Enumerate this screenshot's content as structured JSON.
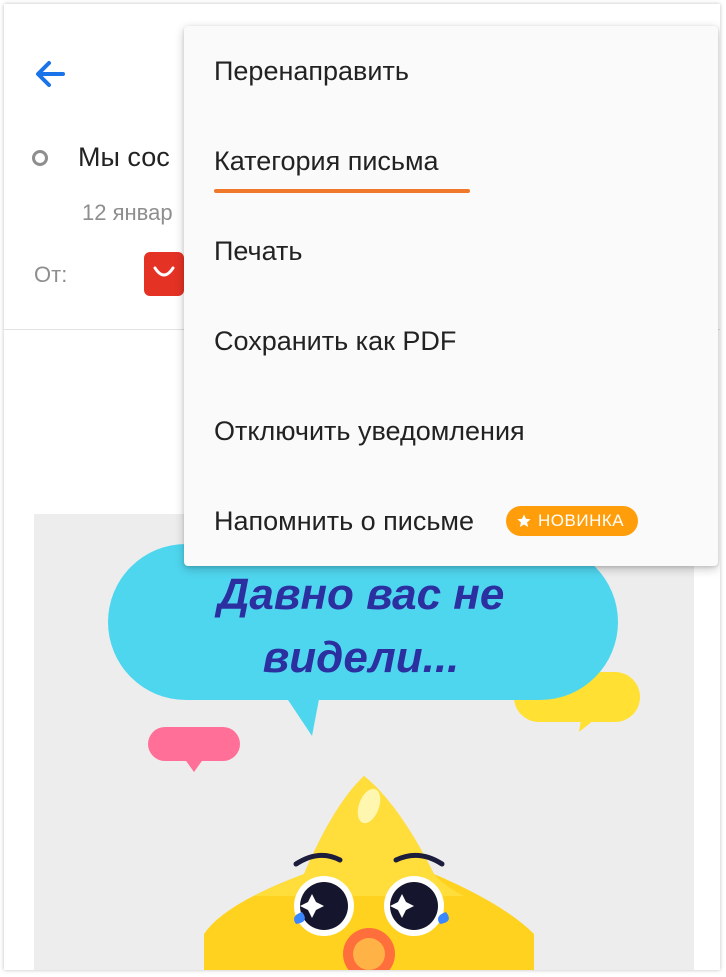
{
  "header": {
    "back_icon": "arrow-left-icon",
    "subject": "Мы сос",
    "date": "12 январ",
    "from_label": "От:"
  },
  "menu": {
    "items": [
      {
        "label": "Перенаправить"
      },
      {
        "label": "Категория письма"
      },
      {
        "label": "Печать"
      },
      {
        "label": "Сохранить как PDF"
      },
      {
        "label": "Отключить уведомления"
      },
      {
        "label": "Напомнить о письме",
        "badge": "НОВИНКА"
      }
    ]
  },
  "promo": {
    "headline_line1": "Давно вас не",
    "headline_line2": "видели..."
  },
  "colors": {
    "accent_blue": "#1a73e8",
    "underline_orange": "#f0782a",
    "badge_orange": "#ff9e0a",
    "bubble_cyan": "#4fd6ef",
    "headline_navy": "#2b2fa0"
  }
}
